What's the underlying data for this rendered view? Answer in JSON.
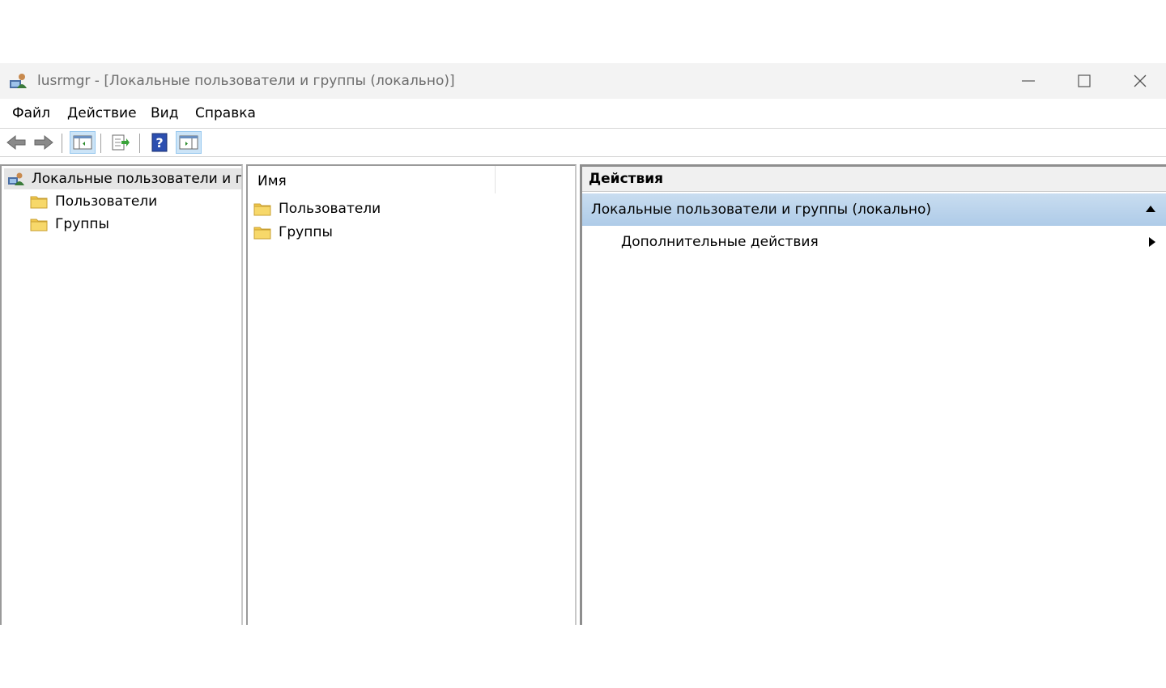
{
  "window": {
    "title": "lusrmgr - [Локальные пользователи и группы (локально)]"
  },
  "menu": {
    "items": [
      "Файл",
      "Действие",
      "Вид",
      "Справка"
    ]
  },
  "toolbar": {
    "buttons": [
      "back-arrow-icon",
      "forward-arrow-icon",
      "show-hide-tree-icon",
      "export-list-icon",
      "help-icon",
      "show-hide-action-pane-icon"
    ]
  },
  "tree": {
    "root": "Локальные пользователи и группы (локально)",
    "children": [
      "Пользователи",
      "Группы"
    ]
  },
  "list": {
    "column_name": "Имя",
    "items": [
      "Пользователи",
      "Группы"
    ]
  },
  "actions": {
    "header": "Действия",
    "section_title": "Локальные пользователи и группы (локально)",
    "items": [
      "Дополнительные действия"
    ]
  },
  "colors": {
    "selection_blue": "#b7d2ec",
    "folder_yellow": "#f2c94c"
  }
}
